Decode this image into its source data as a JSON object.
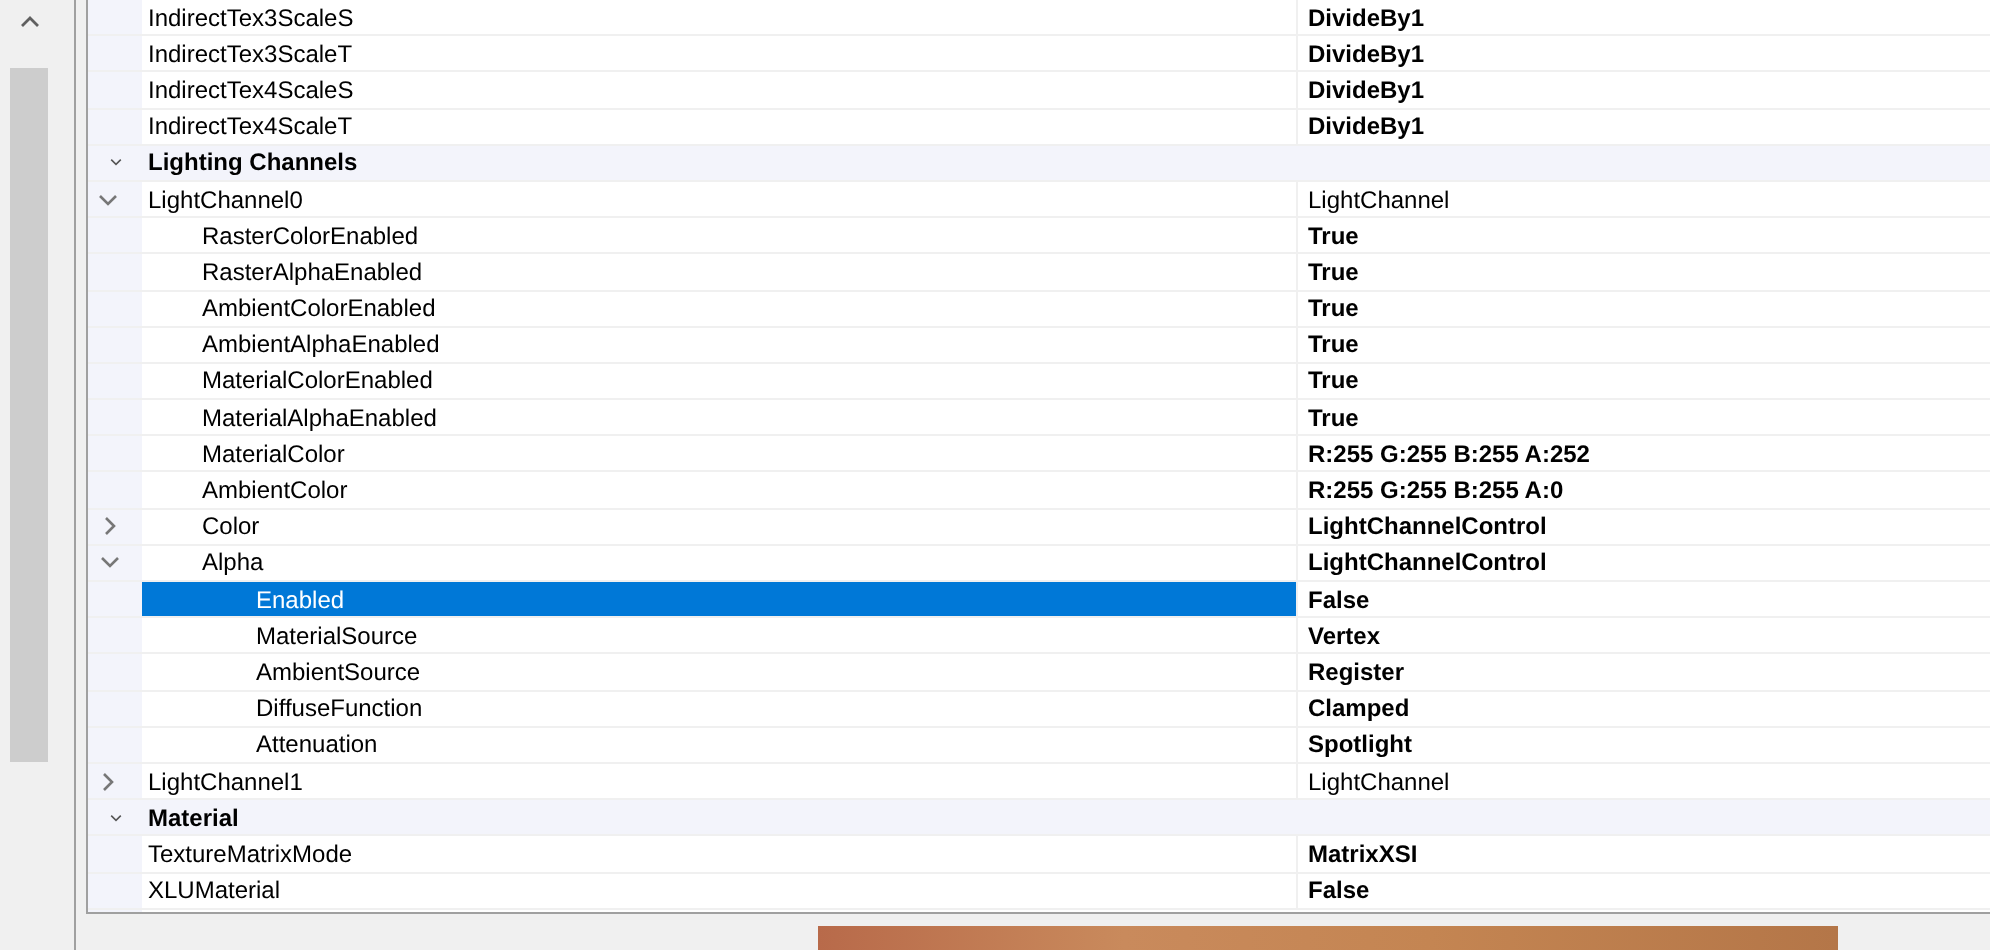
{
  "rows": [
    {
      "kind": "property",
      "name": "IndirectTex3ScaleS",
      "value": "DivideBy1",
      "modified": true,
      "selected": false
    },
    {
      "kind": "property",
      "name": "IndirectTex3ScaleT",
      "value": "DivideBy1",
      "modified": true,
      "selected": false
    },
    {
      "kind": "property",
      "name": "IndirectTex4ScaleS",
      "value": "DivideBy1",
      "modified": true,
      "selected": false
    },
    {
      "kind": "property",
      "name": "IndirectTex4ScaleT",
      "value": "DivideBy1",
      "modified": true,
      "selected": false
    },
    {
      "kind": "category",
      "name": "Lighting Channels",
      "expanded": true,
      "selected": false,
      "children": [
        {
          "name": "LightChannel0",
          "value": "LightChannel",
          "modified": false,
          "expanded": true,
          "selected": false,
          "children": [
            {
              "name": "RasterColorEnabled",
              "value": "True",
              "modified": true,
              "selected": false
            },
            {
              "name": "RasterAlphaEnabled",
              "value": "True",
              "modified": true,
              "selected": false
            },
            {
              "name": "AmbientColorEnabled",
              "value": "True",
              "modified": true,
              "selected": false
            },
            {
              "name": "AmbientAlphaEnabled",
              "value": "True",
              "modified": true,
              "selected": false
            },
            {
              "name": "MaterialColorEnabled",
              "value": "True",
              "modified": true,
              "selected": false
            },
            {
              "name": "MaterialAlphaEnabled",
              "value": "True",
              "modified": true,
              "selected": false
            },
            {
              "name": "MaterialColor",
              "value": "R:255 G:255 B:255 A:252",
              "modified": true,
              "selected": false
            },
            {
              "name": "AmbientColor",
              "value": "R:255 G:255 B:255 A:0",
              "modified": true,
              "selected": false
            },
            {
              "name": "Color",
              "value": "LightChannelControl",
              "modified": true,
              "expanded": false,
              "selected": false
            },
            {
              "name": "Alpha",
              "value": "LightChannelControl",
              "modified": true,
              "expanded": true,
              "selected": false,
              "children": [
                {
                  "name": "Enabled",
                  "value": "False",
                  "modified": true,
                  "selected": true
                },
                {
                  "name": "MaterialSource",
                  "value": "Vertex",
                  "modified": true,
                  "selected": false
                },
                {
                  "name": "AmbientSource",
                  "value": "Register",
                  "modified": true,
                  "selected": false
                },
                {
                  "name": "DiffuseFunction",
                  "value": "Clamped",
                  "modified": true,
                  "selected": false
                },
                {
                  "name": "Attenuation",
                  "value": "Spotlight",
                  "modified": true,
                  "selected": false
                }
              ]
            }
          ]
        },
        {
          "name": "LightChannel1",
          "value": "LightChannel",
          "modified": false,
          "expanded": false,
          "selected": false
        }
      ]
    },
    {
      "kind": "category",
      "name": "Material",
      "expanded": true,
      "selected": false,
      "children": [
        {
          "name": "TextureMatrixMode",
          "value": "MatrixXSI",
          "modified": true,
          "selected": false
        },
        {
          "name": "XLUMaterial",
          "value": "False",
          "modified": true,
          "selected": false
        }
      ]
    }
  ]
}
